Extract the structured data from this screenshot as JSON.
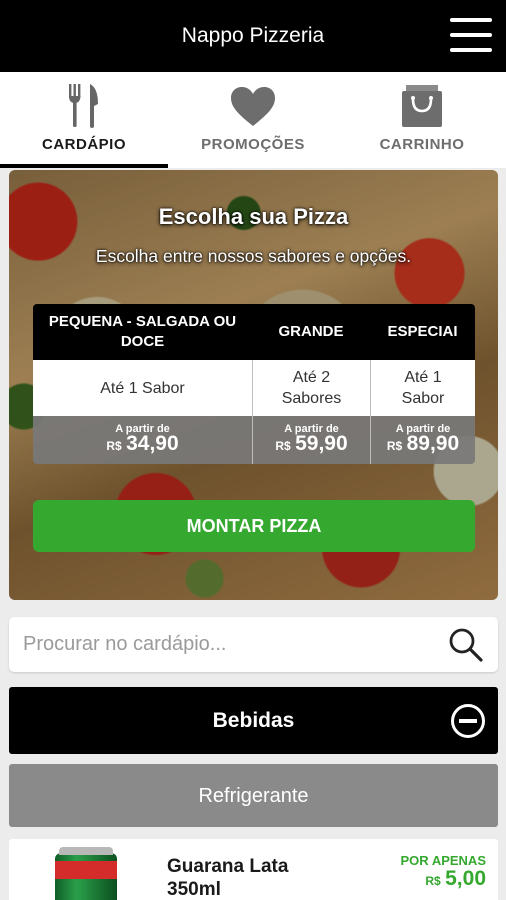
{
  "app": {
    "title": "Nappo Pizzeria"
  },
  "tabs": [
    {
      "label": "CARDÁPIO",
      "icon": "fork-knife-icon",
      "active": true
    },
    {
      "label": "PROMOÇÕES",
      "icon": "heart-icon",
      "active": false
    },
    {
      "label": "CARRINHO",
      "icon": "shopping-bag-icon",
      "active": false
    }
  ],
  "hero": {
    "title": "Escolha sua Pizza",
    "subtitle": "Escolha entre nossos sabores e opções.",
    "sizes": [
      {
        "name": "PEQUENA - SALGADA OU DOCE",
        "flavors": "Até 1 Sabor",
        "from_label": "A partir de",
        "currency": "R$",
        "price": "34,90"
      },
      {
        "name": "GRANDE",
        "flavors": "Até 2 Sabores",
        "from_label": "A partir de",
        "currency": "R$",
        "price": "59,90"
      },
      {
        "name": "ESPECIAI",
        "flavors": "Até 1 Sabor",
        "from_label": "A partir de",
        "currency": "R$",
        "price": "89,90"
      }
    ],
    "button_label": "MONTAR PIZZA"
  },
  "search": {
    "placeholder": "Procurar no cardápio...",
    "value": ""
  },
  "category": {
    "title": "Bebidas",
    "expanded": true
  },
  "subcategory": {
    "title": "Refrigerante"
  },
  "products": [
    {
      "name": "Guarana Lata 350ml",
      "price_label": "POR APENAS",
      "currency": "R$",
      "price": "5,00"
    }
  ],
  "colors": {
    "accent_green": "#35a82f",
    "bar_black": "#000000",
    "subcategory_gray": "#8a8a8a"
  }
}
